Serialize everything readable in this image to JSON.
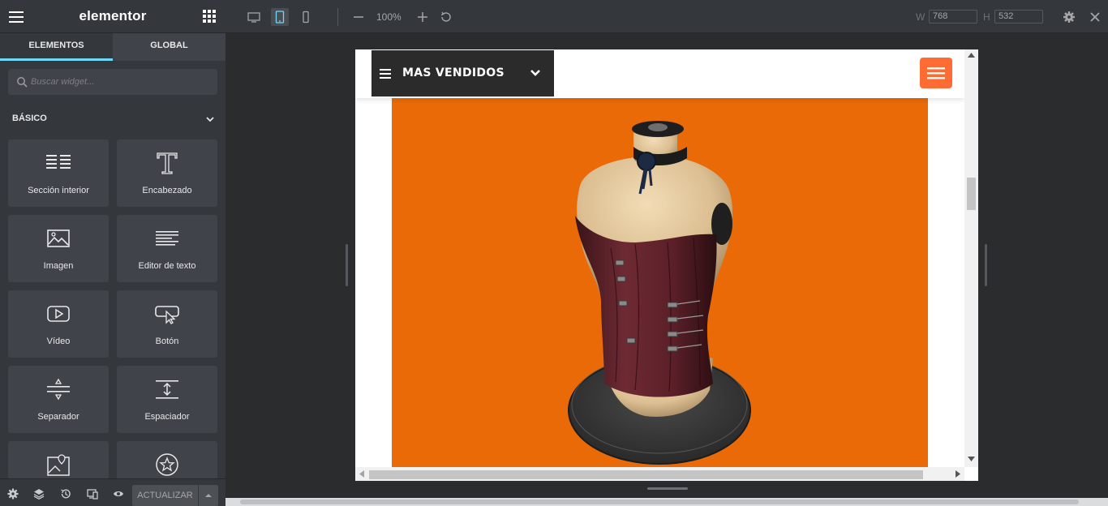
{
  "sidebar": {
    "brand": "elementor",
    "tabs": [
      {
        "label": "ELEMENTOS",
        "active": true
      },
      {
        "label": "GLOBAL",
        "active": false
      }
    ],
    "search_placeholder": "Buscar widget...",
    "category": "BÁSICO",
    "widgets": [
      {
        "label": "Sección interior",
        "icon": "inner-section-icon"
      },
      {
        "label": "Encabezado",
        "icon": "heading-icon"
      },
      {
        "label": "Imagen",
        "icon": "image-icon"
      },
      {
        "label": "Editor de texto",
        "icon": "text-editor-icon"
      },
      {
        "label": "Vídeo",
        "icon": "video-icon"
      },
      {
        "label": "Botón",
        "icon": "button-icon"
      },
      {
        "label": "Separador",
        "icon": "divider-icon"
      },
      {
        "label": "Espaciador",
        "icon": "spacer-icon"
      },
      {
        "label": "",
        "icon": "google-maps-icon"
      },
      {
        "label": "",
        "icon": "star-icon"
      }
    ],
    "footer": {
      "update_label": "ACTUALIZAR",
      "icons": [
        "settings-icon",
        "navigator-icon",
        "history-icon",
        "responsive-icon",
        "preview-icon"
      ]
    }
  },
  "topbar": {
    "devices": [
      "desktop-icon",
      "tablet-icon",
      "mobile-icon"
    ],
    "active_device": "tablet",
    "zoom": "100%",
    "width_label": "W",
    "width_value": "768",
    "height_label": "H",
    "height_value": "532"
  },
  "preview": {
    "menu_label": "MAS VENDIDOS",
    "accent": "#ff6c33",
    "hero_background": "#ea6a07",
    "hero_subject": "mannequin-with-corset"
  },
  "colors": {
    "panel": "#34383c",
    "tab_active_underline": "#71d7f7",
    "canvas": "#2b2c2e"
  }
}
